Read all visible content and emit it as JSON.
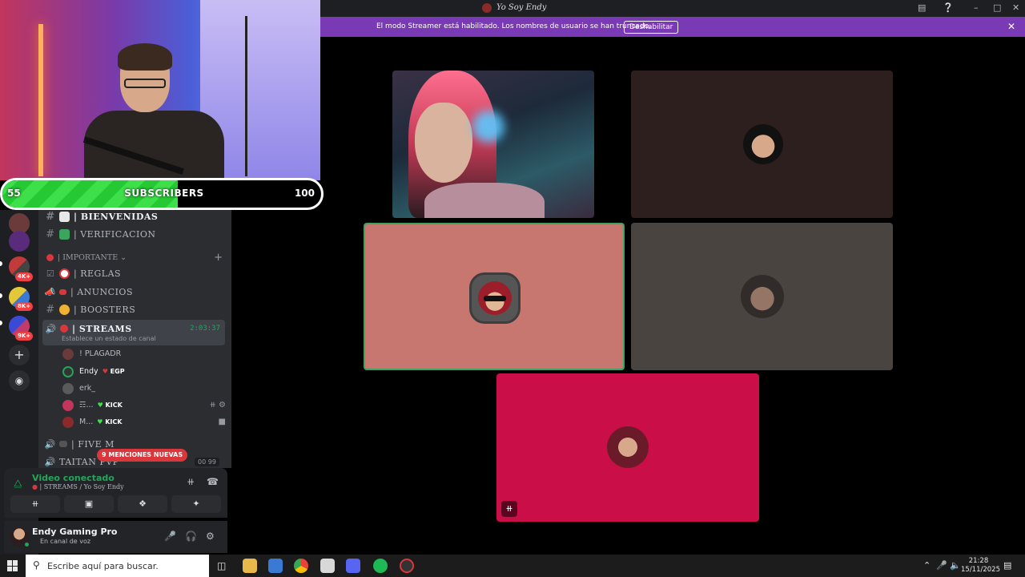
{
  "subscribers": {
    "current": "55",
    "label": "SUBSCRIBERS",
    "goal": "100",
    "progress": 0.55
  },
  "window": {
    "title": "Yo Soy Endy"
  },
  "banner": {
    "text": "El modo Streamer está habilitado. Los nombres de usuario se han truncado.",
    "button": "Deshabilitar"
  },
  "servers": [
    {
      "badge": "4K+"
    },
    {
      "badge": "8K+"
    },
    {
      "badge": "9K+"
    }
  ],
  "channels": {
    "bienvenidas": "| BIENVENIDAS",
    "verificacion": "| VERIFICACION",
    "category": "| IMPORTANTE",
    "reglas": "| REGLAS",
    "anuncios": "| ANUNCIOS",
    "boosters": "| BOOSTERS",
    "streams": "| STREAMS",
    "streams_timer": "2:03:37",
    "streams_status": "Establece un estado de canal",
    "fivem": "| FIVE M",
    "taitan": "TAITAN PVP",
    "mentions": "9 MENCIONES NUEVAS",
    "counts": "00  99"
  },
  "members": [
    {
      "name": "! PLAGADR",
      "tag": ""
    },
    {
      "name": "Endy",
      "tag": "EGP"
    },
    {
      "name": "erk_",
      "tag": ""
    },
    {
      "name": "☶...",
      "tag": "KICK"
    },
    {
      "name": "M...",
      "tag": "KICK"
    }
  ],
  "voice": {
    "title": "Video conectado",
    "channel": "| STREAMS / Yo Soy Endy"
  },
  "user": {
    "name": "Endy Gaming Pro",
    "status": "En canal de voz"
  },
  "taskbar": {
    "search_placeholder": "Escribe aquí para buscar.",
    "time": "21:28",
    "date": "15/11/2025"
  },
  "colors": {
    "accent_green": "#23a55a",
    "banner_purple": "#7a3ab6",
    "tile_pink": "#ca0f48"
  }
}
